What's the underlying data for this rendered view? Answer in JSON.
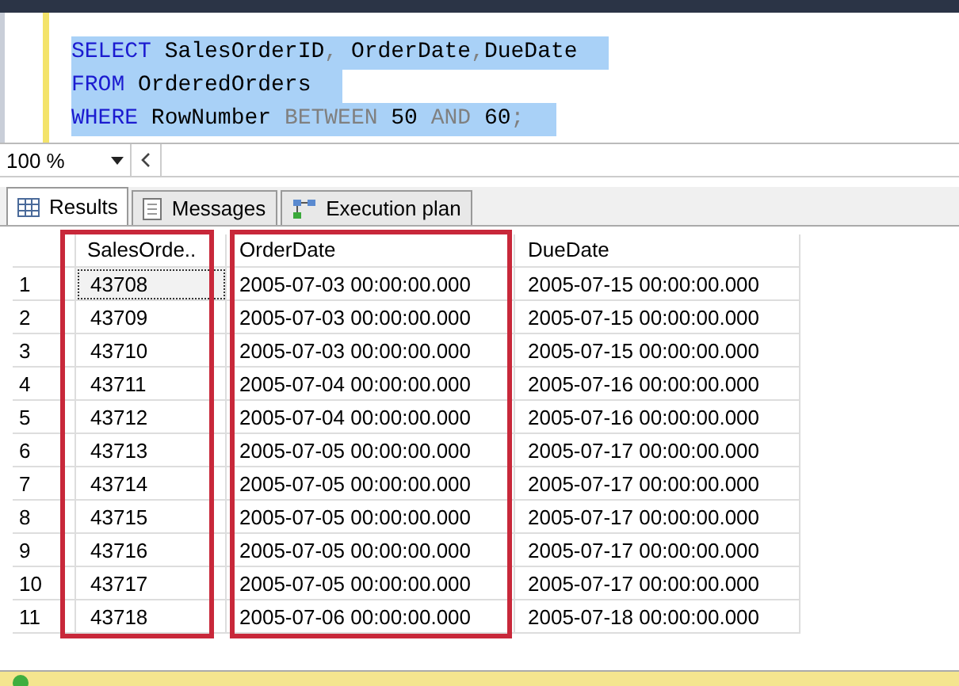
{
  "editor": {
    "lines": [
      {
        "selected": true,
        "tokens": [
          {
            "kind": "keyword",
            "text": "SELECT"
          },
          {
            "kind": "text",
            "text": " SalesOrderID"
          },
          {
            "kind": "operator",
            "text": ","
          },
          {
            "kind": "text",
            "text": " OrderDate"
          },
          {
            "kind": "operator",
            "text": ","
          },
          {
            "kind": "text",
            "text": "DueDate"
          }
        ]
      },
      {
        "selected": true,
        "tokens": [
          {
            "kind": "keyword",
            "text": "FROM"
          },
          {
            "kind": "text",
            "text": " OrderedOrders"
          }
        ]
      },
      {
        "selected": true,
        "tokens": [
          {
            "kind": "keyword",
            "text": "WHERE"
          },
          {
            "kind": "text",
            "text": " RowNumber "
          },
          {
            "kind": "operator",
            "text": "BETWEEN"
          },
          {
            "kind": "text",
            "text": " 50 "
          },
          {
            "kind": "operator",
            "text": "AND"
          },
          {
            "kind": "text",
            "text": " 60"
          },
          {
            "kind": "operator",
            "text": ";"
          }
        ]
      }
    ]
  },
  "zoom": {
    "value": "100 %"
  },
  "tabs": [
    {
      "label": "Results",
      "kind": "grid",
      "selected": true
    },
    {
      "label": "Messages",
      "kind": "document",
      "selected": false
    },
    {
      "label": "Execution plan",
      "kind": "plan",
      "selected": false
    }
  ],
  "grid": {
    "columns": [
      {
        "label": "SalesOrde..",
        "highlighted": true
      },
      {
        "label": "OrderDate",
        "highlighted": true
      },
      {
        "label": "DueDate",
        "highlighted": false
      }
    ],
    "rows": [
      {
        "number": "1",
        "focused": true,
        "cells": [
          "43708",
          "2005-07-03 00:00:00.000",
          "2005-07-15 00:00:00.000"
        ]
      },
      {
        "number": "2",
        "focused": false,
        "cells": [
          "43709",
          "2005-07-03 00:00:00.000",
          "2005-07-15 00:00:00.000"
        ]
      },
      {
        "number": "3",
        "focused": false,
        "cells": [
          "43710",
          "2005-07-03 00:00:00.000",
          "2005-07-15 00:00:00.000"
        ]
      },
      {
        "number": "4",
        "focused": false,
        "cells": [
          "43711",
          "2005-07-04 00:00:00.000",
          "2005-07-16 00:00:00.000"
        ]
      },
      {
        "number": "5",
        "focused": false,
        "cells": [
          "43712",
          "2005-07-04 00:00:00.000",
          "2005-07-16 00:00:00.000"
        ]
      },
      {
        "number": "6",
        "focused": false,
        "cells": [
          "43713",
          "2005-07-05 00:00:00.000",
          "2005-07-17 00:00:00.000"
        ]
      },
      {
        "number": "7",
        "focused": false,
        "cells": [
          "43714",
          "2005-07-05 00:00:00.000",
          "2005-07-17 00:00:00.000"
        ]
      },
      {
        "number": "8",
        "focused": false,
        "cells": [
          "43715",
          "2005-07-05 00:00:00.000",
          "2005-07-17 00:00:00.000"
        ]
      },
      {
        "number": "9",
        "focused": false,
        "cells": [
          "43716",
          "2005-07-05 00:00:00.000",
          "2005-07-17 00:00:00.000"
        ]
      },
      {
        "number": "10",
        "focused": false,
        "cells": [
          "43717",
          "2005-07-05 00:00:00.000",
          "2005-07-17 00:00:00.000"
        ]
      },
      {
        "number": "11",
        "focused": false,
        "cells": [
          "43718",
          "2005-07-06 00:00:00.000",
          "2005-07-18 00:00:00.000"
        ]
      }
    ]
  }
}
